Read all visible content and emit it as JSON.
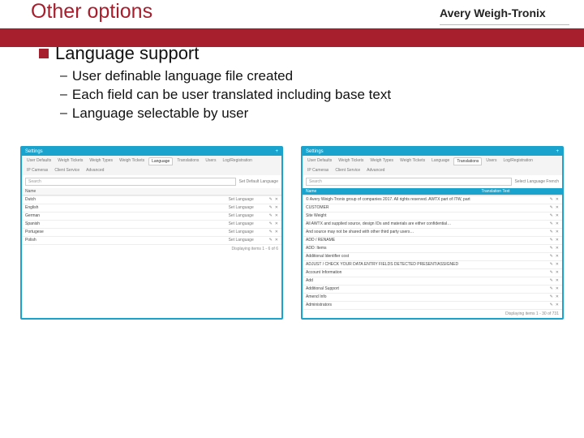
{
  "brand": "Avery Weigh-Tronix",
  "title": "Other options",
  "heading": "Language support",
  "bullets": [
    "User definable language file created",
    "Each field can be user translated including base text",
    "Language selectable by user"
  ],
  "shot_left": {
    "win": "Settings",
    "tabs": [
      "User Defaults",
      "Weigh Tickets",
      "Weigh Types",
      "Weigh Tickets",
      "Language",
      "Translations",
      "Users",
      "Log/Registration",
      "IP Cameras",
      "Client Service",
      "Advanced"
    ],
    "active_tab": 4,
    "search": "Search",
    "selector": "Set Default Language",
    "head": "Name",
    "col2": "",
    "rows": [
      {
        "a": "Dutch",
        "b": "Set Language"
      },
      {
        "a": "English",
        "b": "Set Language"
      },
      {
        "a": "German",
        "b": "Set Language"
      },
      {
        "a": "Spanish",
        "b": "Set Language"
      },
      {
        "a": "Portugese",
        "b": "Set Language"
      },
      {
        "a": "Polish",
        "b": "Set Language"
      }
    ],
    "foot": "Displaying items 1 - 6 of 6"
  },
  "shot_right": {
    "win": "Settings",
    "tabs": [
      "User Defaults",
      "Weigh Tickets",
      "Weigh Types",
      "Weigh Tickets",
      "Language",
      "Translations",
      "Users",
      "Log/Registration",
      "IP Cameras",
      "Client Service",
      "Advanced"
    ],
    "active_tab": 5,
    "search": "Search",
    "selector": "Select Language French",
    "head": "Name",
    "col2": "Translation Text",
    "rows": [
      {
        "a": "© Avery Weigh-Tronix group of companies 2017. All rights reserved. AWTX part of ITW, part",
        "b": ""
      },
      {
        "a": "CUSTOMER",
        "b": ""
      },
      {
        "a": "Site Weight",
        "b": ""
      },
      {
        "a": "All AWTX and supplied source, design IDs and materials are either confidential…",
        "b": ""
      },
      {
        "a": "And source may not be shared with other third party users…",
        "b": ""
      },
      {
        "a": "ADD / RENAME",
        "b": ""
      },
      {
        "a": "ADD: Items",
        "b": ""
      },
      {
        "a": "Additional Identifier cost",
        "b": ""
      },
      {
        "a": "ADJUST / CHECK YOUR DATA ENTRY FIELDS DETECTED PRESENT/ASSIGNED",
        "b": ""
      },
      {
        "a": "Account Information",
        "b": ""
      },
      {
        "a": "Add",
        "b": ""
      },
      {
        "a": "Additional Support",
        "b": ""
      },
      {
        "a": "Amend Info",
        "b": ""
      },
      {
        "a": "Administrators",
        "b": ""
      }
    ],
    "foot": "Displaying items 1 - 30 of 731"
  },
  "icons": {
    "edit": "✎",
    "del": "✕",
    "plus": "+"
  }
}
